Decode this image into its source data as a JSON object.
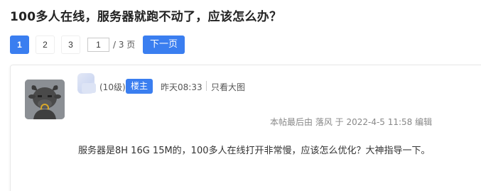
{
  "thread": {
    "title": "100多人在线，服务器就跑不动了，应该怎么办？"
  },
  "pagination": {
    "pages": [
      "1",
      "2",
      "3"
    ],
    "current_page": "1",
    "total_label": "/ 3 页",
    "next_label": "下一页"
  },
  "post": {
    "username": "",
    "level": "(10级)",
    "op_badge": "楼主",
    "time": "昨天08:33",
    "only_op_label": "只看大图",
    "edit_note": "本帖最后由 落风 于 2022-4-5 11:58 编辑",
    "content": "服务器是8H 16G 15M的，100多人在线打开非常慢，应该怎么优化？大神指导一下。",
    "avatar_icon": "cartoon-ox-avatar-icon"
  },
  "colors": {
    "accent": "#3a7ef0",
    "text": "#333333",
    "muted": "#888888",
    "border": "#e8e8e8"
  }
}
